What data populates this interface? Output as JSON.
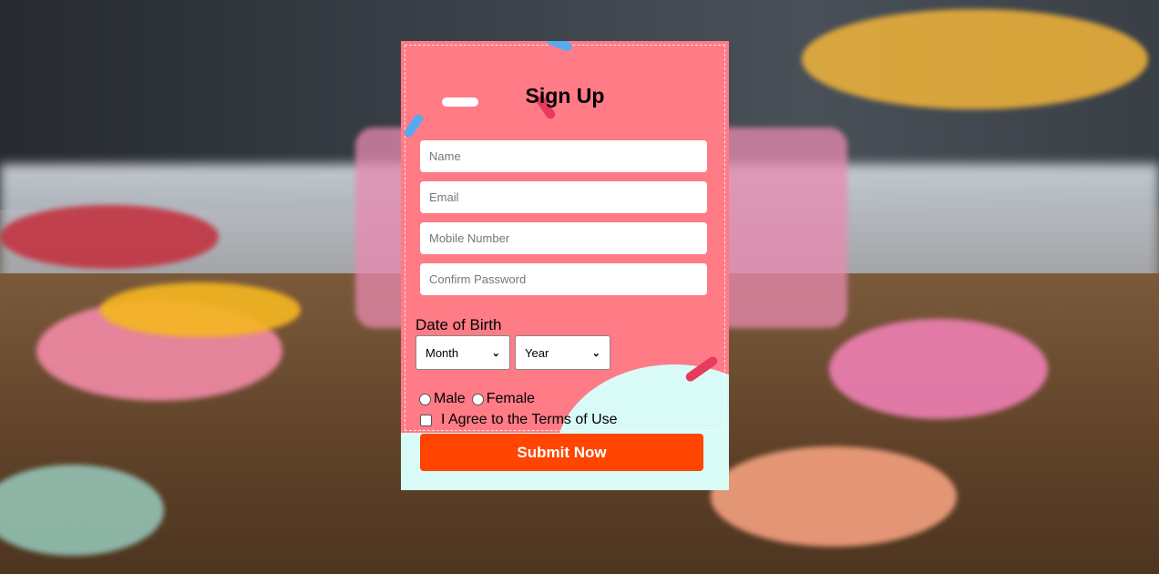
{
  "form": {
    "title": "Sign Up",
    "fields": [
      {
        "placeholder": "Name"
      },
      {
        "placeholder": "Email"
      },
      {
        "placeholder": "Mobile Number"
      },
      {
        "placeholder": "Confirm Password"
      }
    ],
    "dob_label": "Date of Birth",
    "month_select": "Month",
    "year_select": "Year",
    "gender_male": "Male",
    "gender_female": "Female",
    "terms_label": "I Agree to the Terms of Use",
    "submit_label": "Submit Now"
  },
  "colors": {
    "card": "#ff7b86",
    "accent_mint": "#d9fbf8",
    "submit": "#ff4500"
  }
}
